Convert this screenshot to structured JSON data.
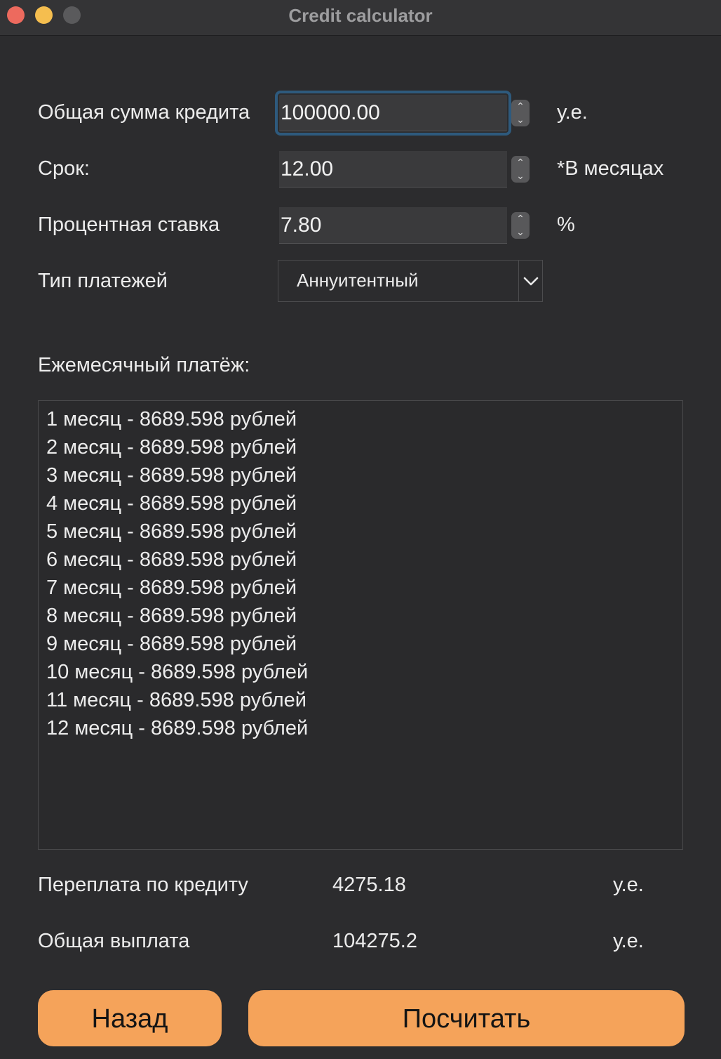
{
  "window": {
    "title": "Credit calculator"
  },
  "form": {
    "amount": {
      "label": "Общая сумма кредита",
      "value": "100000.00",
      "unit": "у.е."
    },
    "term": {
      "label": "Срок:",
      "value": "12.00",
      "unit": "*В месяцах"
    },
    "rate": {
      "label": "Процентная ставка",
      "value": "7.80",
      "unit": "%"
    },
    "payment_type": {
      "label": "Тип платежей",
      "selected": "Аннуитентный"
    }
  },
  "monthly": {
    "label": "Ежемесячный платёж:",
    "items": [
      "1 месяц - 8689.598 рублей",
      "2 месяц - 8689.598 рублей",
      "3 месяц - 8689.598 рублей",
      "4 месяц - 8689.598 рублей",
      "5 месяц - 8689.598 рублей",
      "6 месяц - 8689.598 рублей",
      "7 месяц - 8689.598 рублей",
      "8 месяц - 8689.598 рублей",
      "9 месяц - 8689.598 рублей",
      "10 месяц - 8689.598 рублей",
      "11 месяц - 8689.598 рублей",
      "12 месяц - 8689.598 рублей"
    ]
  },
  "summary": {
    "overpayment": {
      "label": "Переплата по кредиту",
      "value": "4275.18",
      "unit": "у.е."
    },
    "total": {
      "label": "Общая выплата",
      "value": "104275.2",
      "unit": "у.е."
    }
  },
  "buttons": {
    "back": "Назад",
    "calculate": "Посчитать"
  },
  "colors": {
    "background": "#2c2c2e",
    "accent_button": "#f5a35a",
    "focus_ring": "#2e5a7d",
    "close": "#ed6a5e",
    "minimize": "#f5be4f"
  }
}
